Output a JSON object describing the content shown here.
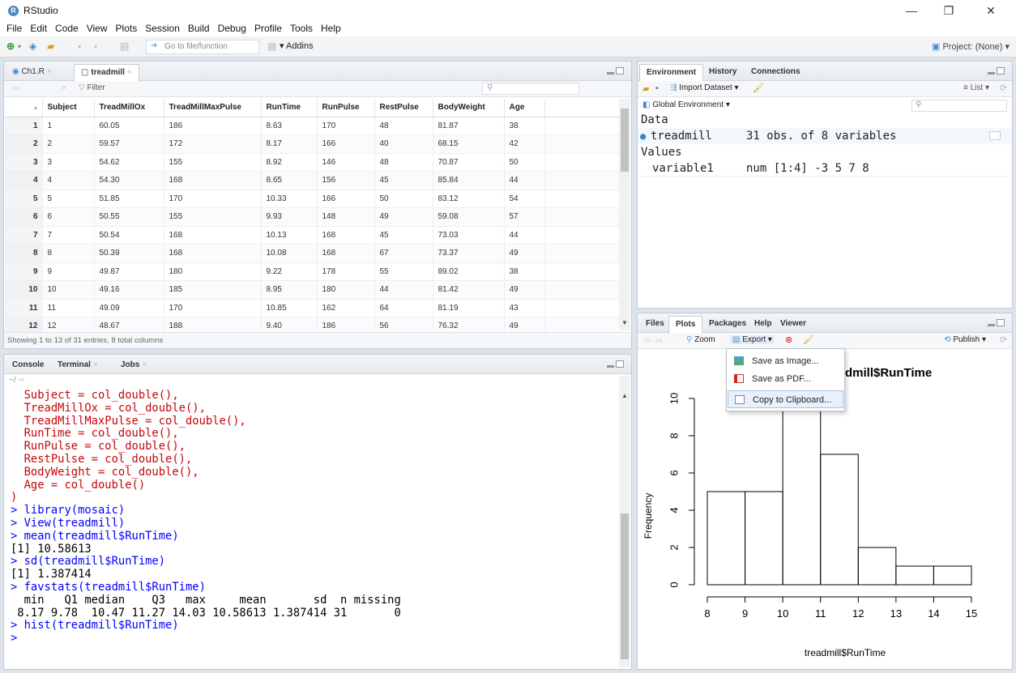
{
  "window": {
    "title": "RStudio",
    "app_icon_letter": "R",
    "minimize": "—",
    "maximize": "❐",
    "close": "✕"
  },
  "menubar": [
    "File",
    "Edit",
    "Code",
    "View",
    "Plots",
    "Session",
    "Build",
    "Debug",
    "Profile",
    "Tools",
    "Help"
  ],
  "toolbar": {
    "goto_placeholder": "Go to file/function",
    "addins": "Addins",
    "project": "Project: (None)"
  },
  "source": {
    "tabs": [
      {
        "label": "Ch1.R"
      },
      {
        "label": "treadmill"
      }
    ],
    "filter_label": "Filter",
    "columns": [
      "",
      "Subject",
      "TreadMillOx",
      "TreadMillMaxPulse",
      "RunTime",
      "RunPulse",
      "RestPulse",
      "BodyWeight",
      "Age"
    ],
    "rows": [
      [
        "1",
        "1",
        "60.05",
        "186",
        "8.63",
        "170",
        "48",
        "81.87",
        "38"
      ],
      [
        "2",
        "2",
        "59.57",
        "172",
        "8.17",
        "166",
        "40",
        "68.15",
        "42"
      ],
      [
        "3",
        "3",
        "54.62",
        "155",
        "8.92",
        "146",
        "48",
        "70.87",
        "50"
      ],
      [
        "4",
        "4",
        "54.30",
        "168",
        "8.65",
        "156",
        "45",
        "85.84",
        "44"
      ],
      [
        "5",
        "5",
        "51.85",
        "170",
        "10.33",
        "166",
        "50",
        "83.12",
        "54"
      ],
      [
        "6",
        "6",
        "50.55",
        "155",
        "9.93",
        "148",
        "49",
        "59.08",
        "57"
      ],
      [
        "7",
        "7",
        "50.54",
        "168",
        "10.13",
        "168",
        "45",
        "73.03",
        "44"
      ],
      [
        "8",
        "8",
        "50.39",
        "168",
        "10.08",
        "168",
        "67",
        "73.37",
        "49"
      ],
      [
        "9",
        "9",
        "49.87",
        "180",
        "9.22",
        "178",
        "55",
        "89.02",
        "38"
      ],
      [
        "10",
        "10",
        "49.16",
        "185",
        "8.95",
        "180",
        "44",
        "81.42",
        "49"
      ],
      [
        "11",
        "11",
        "49.09",
        "170",
        "10.85",
        "162",
        "64",
        "81.19",
        "43"
      ],
      [
        "12",
        "12",
        "48.67",
        "188",
        "9.40",
        "186",
        "56",
        "76.32",
        "49"
      ]
    ],
    "status": "Showing 1 to 13 of 31 entries, 8 total columns"
  },
  "console": {
    "tabs": [
      "Console",
      "Terminal",
      "Jobs"
    ],
    "path": "~/",
    "lines": [
      {
        "t": "  Subject = col_double(),",
        "c": "red"
      },
      {
        "t": "  TreadMillOx = col_double(),",
        "c": "red"
      },
      {
        "t": "  TreadMillMaxPulse = col_double(),",
        "c": "red"
      },
      {
        "t": "  RunTime = col_double(),",
        "c": "red"
      },
      {
        "t": "  RunPulse = col_double(),",
        "c": "red"
      },
      {
        "t": "  RestPulse = col_double(),",
        "c": "red"
      },
      {
        "t": "  BodyWeight = col_double(),",
        "c": "red"
      },
      {
        "t": "  Age = col_double()",
        "c": "red"
      },
      {
        "t": ")",
        "c": "red"
      },
      {
        "t": "> library(mosaic)",
        "c": "blue"
      },
      {
        "t": "> View(treadmill)",
        "c": "blue"
      },
      {
        "t": "> mean(treadmill$RunTime)",
        "c": "blue"
      },
      {
        "t": "[1] 10.58613",
        "c": "black"
      },
      {
        "t": "> sd(treadmill$RunTime)",
        "c": "blue"
      },
      {
        "t": "[1] 1.387414",
        "c": "black"
      },
      {
        "t": "> favstats(treadmill$RunTime)",
        "c": "blue"
      },
      {
        "t": "  min   Q1 median    Q3   max     mean       sd  n missing",
        "c": "black"
      },
      {
        "t": " 8.17 9.78  10.47 11.27 14.03 10.58613 1.387414 31       0",
        "c": "black"
      },
      {
        "t": "> hist(treadmill$RunTime)",
        "c": "blue"
      },
      {
        "t": "> ",
        "c": "blue"
      }
    ]
  },
  "environment": {
    "tabs": [
      "Environment",
      "History",
      "Connections"
    ],
    "import_label": "Import Dataset",
    "list_label": "List",
    "scope": "Global Environment",
    "data_header": "Data",
    "values_header": "Values",
    "data_name": "treadmill",
    "data_desc": "31 obs. of 8 variables",
    "var_name": "variable1",
    "var_desc": "num [1:4] -3 5 7 8"
  },
  "plots": {
    "tabs": [
      "Files",
      "Plots",
      "Packages",
      "Help",
      "Viewer"
    ],
    "zoom": "Zoom",
    "export": "Export",
    "publish": "Publish",
    "export_menu": [
      "Save as Image...",
      "Save as PDF...",
      "Copy to Clipboard..."
    ]
  },
  "chart_data": {
    "type": "bar",
    "title": "dmill$RunTime",
    "xlabel": "treadmill$RunTime",
    "ylabel": "Frequency",
    "bins": [
      [
        8,
        9
      ],
      [
        9,
        10
      ],
      [
        10,
        11
      ],
      [
        11,
        12
      ],
      [
        12,
        13
      ],
      [
        13,
        14
      ],
      [
        14,
        15
      ]
    ],
    "values": [
      5,
      5,
      11,
      7,
      2,
      1,
      1
    ],
    "x_ticks": [
      8,
      9,
      10,
      11,
      12,
      13,
      14,
      15
    ],
    "y_ticks": [
      0,
      2,
      4,
      6,
      8,
      10
    ],
    "xlim": [
      8,
      15
    ],
    "ylim": [
      0,
      11
    ]
  }
}
